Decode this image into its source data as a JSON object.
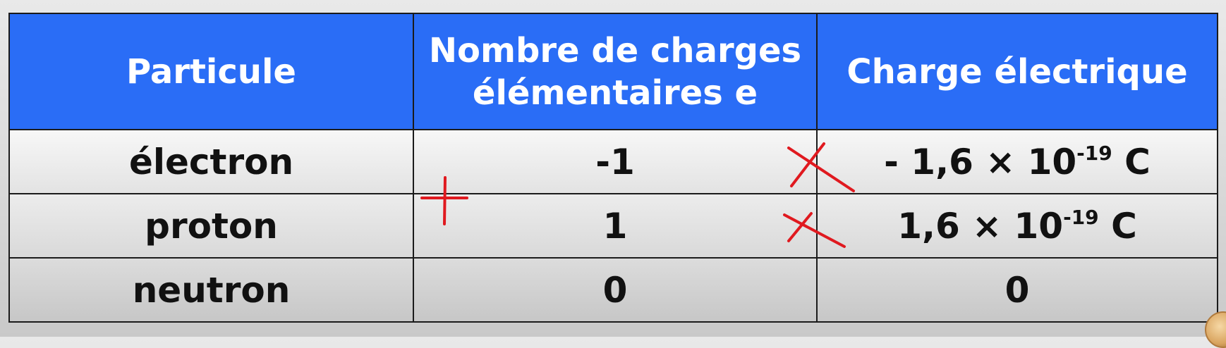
{
  "table": {
    "headers": {
      "particle": "Particule",
      "count_line1": "Nombre de charges",
      "count_line2": "élémentaires e",
      "charge": "Charge électrique"
    },
    "rows": [
      {
        "particle": "électron",
        "count": "-1",
        "charge_prefix": "- 1,6 × 10",
        "charge_exp": "-19",
        "charge_unit": " C"
      },
      {
        "particle": "proton",
        "count": "1",
        "charge_prefix": "1,6 × 10",
        "charge_exp": "-19",
        "charge_unit": " C"
      },
      {
        "particle": "neutron",
        "count": "0",
        "charge": "0"
      }
    ]
  },
  "colors": {
    "header_bg": "#2a6df6",
    "header_text": "#ffffff",
    "border": "#1b1b1b",
    "annotation": "#e0191f"
  },
  "annotations": {
    "marks": [
      "plus-mark",
      "cross-mark",
      "cross-mark"
    ]
  }
}
